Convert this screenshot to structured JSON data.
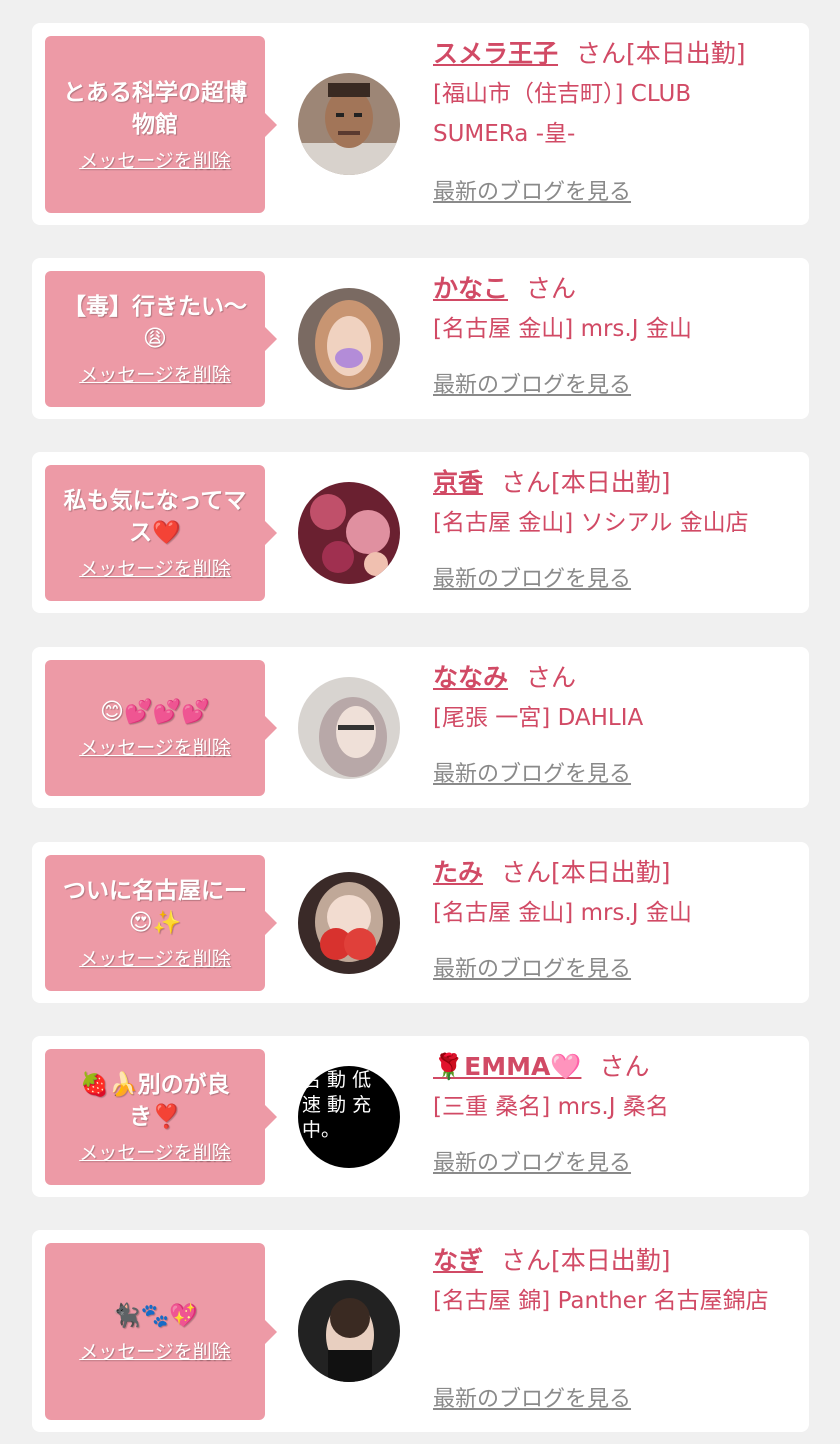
{
  "items": [
    {
      "message": "とある科学の超博物館",
      "delete": "メッセージを削除",
      "name": "スメラ王子",
      "suffix": "さん[本日出勤]",
      "shop": "[福山市（住吉町）] CLUB SUMERa -皇-",
      "blog": "最新のブログを見る"
    },
    {
      "message": "【毒】行きたい〜 😩",
      "delete": "メッセージを削除",
      "name": "かなこ",
      "suffix": "さん",
      "shop": "[名古屋 金山] mrs.J 金山",
      "blog": "最新のブログを見る"
    },
    {
      "message": "私も気になってマス❤️",
      "delete": "メッセージを削除",
      "name": "京香",
      "suffix": "さん[本日出勤]",
      "shop": "[名古屋 金山] ソシアル 金山店",
      "blog": "最新のブログを見る"
    },
    {
      "message": "😊💕💕💕",
      "delete": "メッセージを削除",
      "name": "ななみ",
      "suffix": "さん",
      "shop": "[尾張 一宮] DAHLIA",
      "blog": "最新のブログを見る"
    },
    {
      "message": "ついに名古屋にー 😍✨",
      "delete": "メッセージを削除",
      "name": "たみ",
      "suffix": "さん[本日出勤]",
      "shop": "[名古屋 金山] mrs.J 金山",
      "blog": "最新のブログを見る"
    },
    {
      "message": "🍓🍌別のが良き❣️",
      "delete": "メッセージを削除",
      "name": "🌹EMMA🩷",
      "suffix": "さん",
      "shop": "[三重 桑名] mrs.J 桑名",
      "blog": "最新のブログを見る"
    },
    {
      "message": "🐈‍⬛🐾💖",
      "delete": "メッセージを削除",
      "name": "なぎ",
      "suffix": "さん[本日出勤]",
      "shop": "[名古屋 錦] Panther 名古屋錦店",
      "blog": "最新のブログを見る"
    }
  ],
  "avatar_overlay_text": "名 動 低 速 動 充 中。"
}
